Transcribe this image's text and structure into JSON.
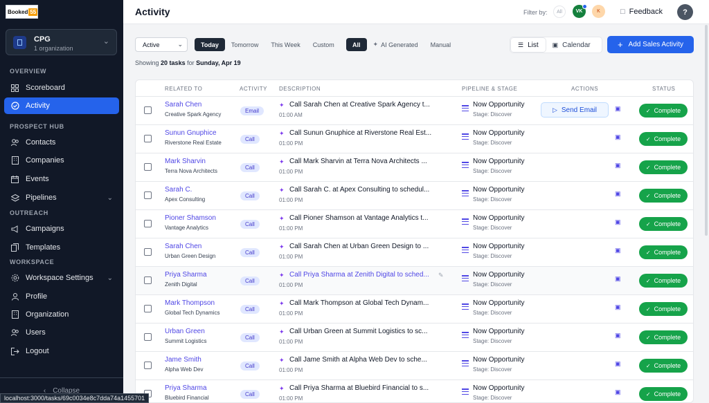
{
  "sidebar": {
    "logo_text": "Booked",
    "logo_num": "55",
    "org": {
      "name": "CPG",
      "sub": "1 organization"
    },
    "sections": {
      "overview": "OVERVIEW",
      "prospect": "PROSPECT HUB",
      "outreach": "OUTREACH",
      "workspace": "WORKSPACE"
    },
    "items": [
      {
        "label": "Scoreboard",
        "icon": "grid-icon"
      },
      {
        "label": "Activity",
        "icon": "check-circle-icon",
        "active": true
      },
      {
        "label": "Contacts",
        "icon": "users-icon"
      },
      {
        "label": "Companies",
        "icon": "building-icon"
      },
      {
        "label": "Events",
        "icon": "calendar-icon"
      },
      {
        "label": "Pipelines",
        "icon": "layers-icon"
      },
      {
        "label": "Campaigns",
        "icon": "megaphone-icon"
      },
      {
        "label": "Templates",
        "icon": "copy-icon"
      },
      {
        "label": "Workspace Settings",
        "icon": "gear-icon"
      },
      {
        "label": "Profile",
        "icon": "user-icon"
      },
      {
        "label": "Organization",
        "icon": "building-icon"
      },
      {
        "label": "Users",
        "icon": "users-icon"
      },
      {
        "label": "Logout",
        "icon": "logout-icon"
      }
    ],
    "collapse": "Collapse"
  },
  "header": {
    "title": "Activity",
    "filter_label": "Filter by:",
    "filter_all": "All",
    "avatar_vk": "VK",
    "avatar_k": "K",
    "feedback": "Feedback",
    "help": "?"
  },
  "toolbar": {
    "status_select": "Active",
    "date_tabs": [
      "Today",
      "Tomorrow",
      "This Week",
      "Custom"
    ],
    "type_tabs": [
      "All",
      "AI Generated",
      "Manual"
    ],
    "view_list": "List",
    "view_calendar": "Calendar",
    "add_button": "Add Sales Activity"
  },
  "summary": {
    "prefix": "Showing",
    "count": "20 tasks",
    "mid": "for",
    "date": "Sunday, Apr 19"
  },
  "table": {
    "headers": [
      "RELATED TO",
      "ACTIVITY",
      "DESCRIPTION",
      "PIPELINE & STAGE",
      "ACTIONS",
      "STATUS"
    ],
    "send_email": "Send Email",
    "rows": [
      {
        "name": "Sarah Chen",
        "company": "Creative Spark Agency",
        "activity": "Email",
        "desc": "Call Sarah Chen at Creative Spark Agency t...",
        "time": "01:00 AM",
        "pipeline": "Now Opportunity",
        "stage": "Stage: Discover",
        "status": "Complete"
      },
      {
        "name": "Sunun Gnuphice",
        "company": "Riverstone Real Estate",
        "activity": "Call",
        "desc": "Call Sunun Gnuphice at Riverstone Real Est...",
        "time": "01:00 PM",
        "pipeline": "Now Opportunity",
        "stage": "Stage: Discover",
        "status": "Complete"
      },
      {
        "name": "Mark Sharvin",
        "company": "Terra Nova Architects",
        "activity": "Call",
        "desc": "Call Mark Sharvin at Terra Nova Architects ...",
        "time": "01:00 PM",
        "pipeline": "Now Opportunity",
        "stage": "Stage: Discover",
        "status": "Complete"
      },
      {
        "name": "Sarah C.",
        "company": "Apex Consulting",
        "activity": "Call",
        "desc": "Call Sarah C. at Apex Consulting to schedul...",
        "time": "01:00 PM",
        "pipeline": "Now Opportunity",
        "stage": "Stage: Discover",
        "status": "Complete"
      },
      {
        "name": "Pioner Shamson",
        "company": "Vantage Analytics",
        "activity": "Call",
        "desc": "Call Pioner Shamson at Vantage Analytics t...",
        "time": "01:00 PM",
        "pipeline": "Now Opportunity",
        "stage": "Stage: Discover",
        "status": "Complete"
      },
      {
        "name": "Sarah Chen",
        "company": "Urban Green Design",
        "activity": "Call",
        "desc": "Call Sarah Chen at Urban Green Design to ...",
        "time": "01:00 PM",
        "pipeline": "Now Opportunity",
        "stage": "Stage: Discover",
        "status": "Complete"
      },
      {
        "name": "Priya Sharma",
        "company": "Zenith Digital",
        "activity": "Call",
        "desc": "Call Priya Sharma at Zenith Digital to sched...",
        "time": "01:00 PM",
        "pipeline": "Now Opportunity",
        "stage": "Stage: Discover",
        "status": "Complete"
      },
      {
        "name": "Mark Thompson",
        "company": "Global Tech Dynamics",
        "activity": "Call",
        "desc": "Call Mark Thompson at Global Tech Dynam...",
        "time": "01:00 PM",
        "pipeline": "Now Opportunity",
        "stage": "Stage: Discover",
        "status": "Complete"
      },
      {
        "name": "Urban Green",
        "company": "Summit Logistics",
        "activity": "Call",
        "desc": "Call Urban Green at Summit Logistics to sc...",
        "time": "01:00 PM",
        "pipeline": "Now Opportunity",
        "stage": "Stage: Discover",
        "status": "Complete"
      },
      {
        "name": "Jame Smith",
        "company": "Alpha Web Dev",
        "activity": "Call",
        "desc": "Call Jame Smith at Alpha Web Dev to sche...",
        "time": "01:00 PM",
        "pipeline": "Now Opportunity",
        "stage": "Stage: Discover",
        "status": "Complete"
      },
      {
        "name": "Priya Sharma",
        "company": "Bluebird Financial",
        "activity": "Call",
        "desc": "Call Priya Sharma at Bluebird Financial to s...",
        "time": "01:00 PM",
        "pipeline": "Now Opportunity",
        "stage": "Stage: Discover",
        "status": "Complete"
      }
    ]
  },
  "status_url": "localhost:3000/tasks/69c0034e8c7dda74a1455701",
  "colors": {
    "sidebar_bg": "#111827",
    "accent": "#2563eb",
    "complete": "#16a34a",
    "link": "#4f46e5"
  }
}
